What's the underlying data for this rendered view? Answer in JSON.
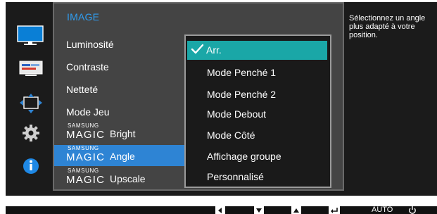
{
  "colors": {
    "osd_background": "#1b1b1b",
    "menu_panel": "#444444",
    "menu_title": "#2f9ef2",
    "selected_item": "#2e84d4",
    "submenu_selected": "#1aa7a7"
  },
  "sidebar": {
    "items": [
      {
        "icon": "picture-monitor-icon",
        "active": true
      },
      {
        "icon": "color-adjust-icon",
        "active": false
      },
      {
        "icon": "screen-size-icon",
        "active": false
      },
      {
        "icon": "settings-gear-icon",
        "active": false
      },
      {
        "icon": "information-icon",
        "active": false
      }
    ]
  },
  "menu": {
    "title": "IMAGE",
    "items": [
      {
        "label": "Luminosité"
      },
      {
        "label": "Contraste"
      },
      {
        "label": "Netteté"
      },
      {
        "label": "Mode Jeu"
      }
    ],
    "magic_items": [
      {
        "brand": "SAMSUNG",
        "magic": "MAGIC",
        "suffix": "Bright"
      },
      {
        "brand": "SAMSUNG",
        "magic": "MAGIC",
        "suffix": "Angle",
        "selected": true
      },
      {
        "brand": "SAMSUNG",
        "magic": "MAGIC",
        "suffix": "Upscale"
      }
    ]
  },
  "submenu": {
    "items": [
      {
        "label": "Arr.",
        "selected": true
      },
      {
        "label": "Mode Penché 1"
      },
      {
        "label": "Mode Penché 2"
      },
      {
        "label": "Mode Debout"
      },
      {
        "label": "Mode Côté"
      },
      {
        "label": "Affichage groupe"
      },
      {
        "label": "Personnalisé"
      }
    ]
  },
  "help": {
    "text": "Sélectionnez un angle plus adapté à votre position."
  },
  "bottom_bar": {
    "buttons": [
      {
        "icon": "left-arrow-icon"
      },
      {
        "icon": "down-arrow-icon"
      },
      {
        "icon": "up-arrow-icon"
      },
      {
        "icon": "enter-icon"
      }
    ],
    "auto_label": "AUTO",
    "power_icon": "power-icon"
  }
}
